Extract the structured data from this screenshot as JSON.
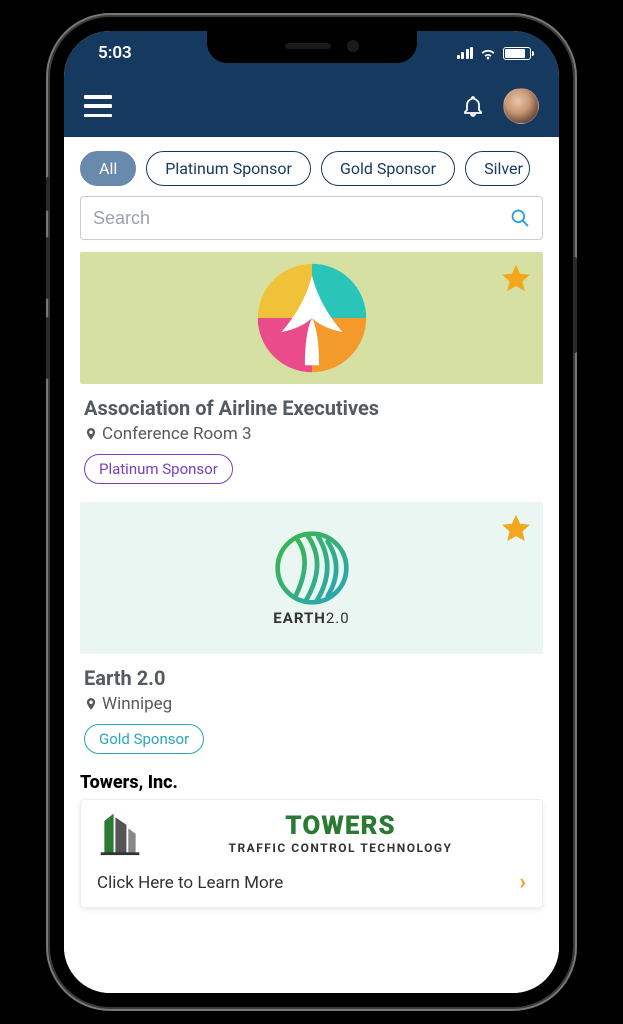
{
  "status": {
    "time": "5:03"
  },
  "filters": {
    "items": [
      "All",
      "Platinum Sponsor",
      "Gold Sponsor",
      "Silver"
    ],
    "active_index": 0
  },
  "search": {
    "placeholder": "Search"
  },
  "sponsors": [
    {
      "title": "Association of Airline Executives",
      "location": "Conference Room 3",
      "tag": "Platinum Sponsor",
      "tag_tier": "platinum",
      "starred": true,
      "logo": "airline-logo"
    },
    {
      "title": "Earth 2.0",
      "location": "Winnipeg",
      "tag": "Gold Sponsor",
      "tag_tier": "gold",
      "starred": true,
      "logo": "earth-logo",
      "logo_label": "EARTH",
      "logo_label_suffix": "2.0"
    }
  ],
  "towers": {
    "heading": "Towers, Inc.",
    "brand": "TOWERS",
    "subline": "TRAFFIC CONTROL TECHNOLOGY",
    "cta": "Click Here to Learn More"
  }
}
